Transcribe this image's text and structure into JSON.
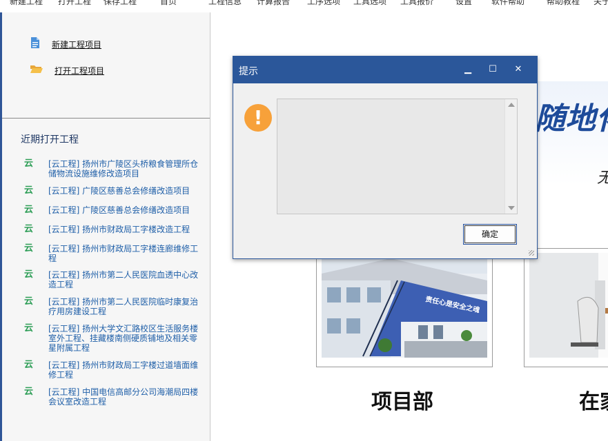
{
  "menubar": {
    "items": [
      "新建工程",
      "打开工程",
      "保存工程",
      "首页",
      "工程信息",
      "计算报告",
      "工序选项",
      "工具选项",
      "工具报价",
      "设置",
      "软件帮助",
      "帮助教程",
      "关于"
    ]
  },
  "sidebar": {
    "actions": [
      {
        "label": "新建工程项目",
        "icon": "document-icon"
      },
      {
        "label": "打开工程项目",
        "icon": "folder-open-icon"
      }
    ],
    "recent_title": "近期打开工程",
    "recent_icon_glyph": "云",
    "recent": [
      "[云工程] 扬州市广陵区头桥粮食管理所仓储物流设施维修改造项目",
      "[云工程] 广陵区慈善总会修缮改造项目",
      "[云工程] 广陵区慈善总会修缮改造项目",
      "[云工程] 扬州市财政局工字楼改造工程",
      "[云工程] 扬州市财政局工字楼连廊维修工程",
      "[云工程] 扬州市第二人民医院血透中心改造工程",
      "[云工程] 扬州市第二人民医院临时康复治疗用房建设工程",
      "[云工程] 扬州大学文汇路校区生活服务楼室外工程、挂藏楼南侧硬质铺地及相关零星附属工程",
      "[云工程] 扬州市财政局工字楼过道墙面维修工程",
      "[云工程] 中国电信高邮分公司海潮局四楼会议室改造工程"
    ]
  },
  "main": {
    "banner_text": "随地化",
    "banner_sub": "无",
    "photo_caption": "责任心是安全之魂",
    "cards": [
      {
        "label": "项目部"
      },
      {
        "label": "在家"
      }
    ]
  },
  "dialog": {
    "title": "提示",
    "message": "",
    "ok_label": "确定",
    "warn_glyph": "!",
    "controls": {
      "minimize": "▁",
      "maximize": "☐",
      "close": "✕"
    }
  },
  "colors": {
    "accent": "#2b579a",
    "link": "#1f5fa8",
    "cloud": "#2e9e57",
    "warning": "#f7a13a"
  }
}
